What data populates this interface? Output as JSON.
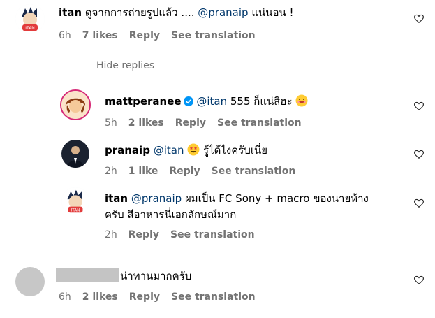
{
  "comments": [
    {
      "username": "itan",
      "text_before": "ดูจากการถ่ายรูปแล้ว .... ",
      "mention": "@pranaip",
      "text_after": " แน่นอน !",
      "time": "6h",
      "likes": "7 likes",
      "reply": "Reply",
      "translate": "See translation"
    },
    {
      "username": "mattperanee",
      "mention": "@itan",
      "text_after": " 555 ก็แน่สิฮะ",
      "time": "5h",
      "likes": "2 likes",
      "reply": "Reply",
      "translate": "See translation"
    },
    {
      "username": "pranaip",
      "mention": "@itan",
      "text_after": " รู้ได้ไงครับเนี่ย",
      "time": "2h",
      "likes": "1 like",
      "reply": "Reply",
      "translate": "See translation"
    },
    {
      "username": "itan",
      "mention": "@pranaip",
      "text_line1": " ผมเป็น FC Sony + macro ของนายห้าง",
      "text_line2": "ครับ สีอาหารนี่เอกลักษณ์มาก",
      "time": "2h",
      "reply": "Reply",
      "translate": "See translation"
    },
    {
      "text_after": "น่าทานมากครับ",
      "time": "6h",
      "likes": "2 likes",
      "reply": "Reply",
      "translate": "See translation"
    }
  ],
  "hide_replies": "Hide replies",
  "icons": {
    "like": "heart-outline-icon",
    "verified": "verified-badge-icon",
    "emoji_smile": "smiling-face-emoji",
    "emoji_star": "star-struck-emoji"
  },
  "colors": {
    "mention": "#00376b",
    "meta": "#737373",
    "verified": "#0095f6"
  }
}
